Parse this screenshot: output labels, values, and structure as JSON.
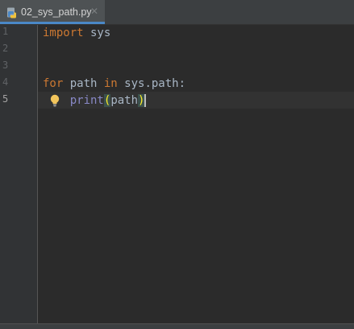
{
  "tab": {
    "label": "02_sys_path.py",
    "close_glyph": "✕",
    "icon": "python-file-icon"
  },
  "line_numbers": [
    "1",
    "2",
    "3",
    "4",
    "5"
  ],
  "code": {
    "line1": {
      "kw": "import",
      "rest": " sys"
    },
    "line4": {
      "kw1": "for",
      "mid1": " path ",
      "kw2": "in",
      "rest": " sys.path:"
    },
    "line5": {
      "indent": "    ",
      "builtin": "print",
      "open": "(",
      "arg": "path",
      "close": ")"
    }
  },
  "colors": {
    "background": "#2b2b2b",
    "keyword": "#cc7832",
    "builtin": "#8888c6",
    "identifier": "#a9b7c6",
    "brace_match": "#ffef28",
    "tab_underline": "#4a88c7"
  },
  "current_line": 5,
  "intention_icon": "lightbulb-icon"
}
